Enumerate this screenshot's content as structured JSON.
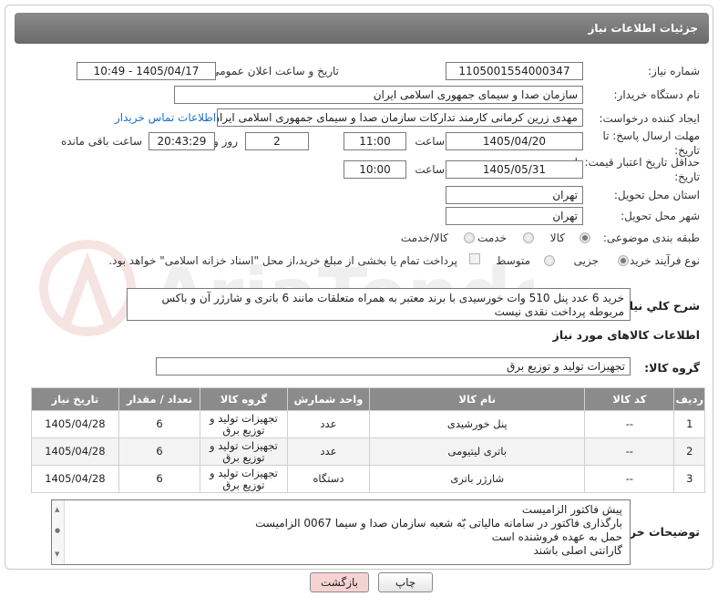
{
  "header": {
    "title": "جزئیات اطلاعات نیاز"
  },
  "labels": {
    "need_number": "شماره نیاز:",
    "announce_datetime": "تاریخ و ساعت اعلان عمومی:",
    "buyer_org": "نام دستگاه خریدار:",
    "requester": "ایجاد کننده درخواست:",
    "reply_deadline": "مهلت ارسال پاسخ: تا تاریخ:",
    "price_validity": "حداقل تاریخ اعتبار قیمت: تا تاریخ:",
    "delivery_province": "استان محل تحویل:",
    "delivery_city": "شهر محل تحویل:",
    "category": "طبقه بندی موضوعی:",
    "purchase_type": "نوع فرآیند خرید :",
    "time": "ساعت",
    "day_and": "روز و",
    "remaining": "ساعت باقی مانده",
    "general_desc": "شرح كلي نياز:",
    "goods_info": "اطلاعات کالاهای مورد نیاز",
    "goods_group": "گروه کالا:",
    "buyer_notes": "توضیحات خریدار:"
  },
  "fields": {
    "need_number": "1105001554000347",
    "announce_datetime": "1405/04/17 - 10:49",
    "buyer_org": "سازمان صدا و سیمای جمهوری اسلامی ایران",
    "requester": "مهدی زرین کرمانی کارمند تدارکات سازمان صدا و سیمای جمهوری اسلامی ایران",
    "reply_date": "1405/04/20",
    "reply_time": "11:00",
    "reply_days": "2",
    "remaining_time": "20:43:29",
    "validity_date": "1405/05/31",
    "validity_time": "10:00",
    "province": "تهران",
    "city": "تهران",
    "goods_group": "تجهیزات تولید و توزیع برق"
  },
  "contact_link": "اطلاعات تماس خریدار",
  "category_options": [
    "کالا",
    "خدمت",
    "کالا/خدمت"
  ],
  "category_selected": "کالا",
  "purchase_options": [
    "جزیی",
    "متوسط"
  ],
  "purchase_selected": "جزیی",
  "payment_note": "پرداخت تمام یا بخشی از مبلغ خرید،از محل \"اسناد خزانه اسلامی\" خواهد بود.",
  "description": "خرید 6 عدد پنل 510 وات خورسیدی با برند معتبر به همراه متعلقات مانند  6 باتری و شارژر آن و باکس مربوطه پرداخت نقدی نیست",
  "table": {
    "headers": [
      "ردیف",
      "کد کالا",
      "نام کالا",
      "واحد شمارش",
      "گروه کالا",
      "تعداد / مقدار",
      "تاریخ نیاز"
    ],
    "rows": [
      [
        "1",
        "--",
        "پنل خورشیدی",
        "عدد",
        "تجهیزات تولید و توزیع برق",
        "6",
        "1405/04/28"
      ],
      [
        "2",
        "--",
        "باتری لیتیومی",
        "عدد",
        "تجهیزات تولید و توزیع برق",
        "6",
        "1405/04/28"
      ],
      [
        "3",
        "--",
        "شارژر باتری",
        "دستگاه",
        "تجهیزات تولید و توزیع برق",
        "6",
        "1405/04/28"
      ]
    ]
  },
  "buyer_notes": [
    "پیش فاکتور الزامیست",
    "بارگذاری فاکتور در سامانه مالیاتی بّه شعبه سازمان صدا و سیما 0067 الزامیست",
    "حمل به عهده فروشنده است",
    "گارانتی اصلی باشند"
  ],
  "buttons": {
    "print": "چاپ",
    "back": "بازگشت"
  },
  "watermark": "AriaTender.net",
  "colors": {
    "header": "#7a7a7a",
    "link": "#1a6fc9",
    "back_button": "#f6d3d3"
  }
}
